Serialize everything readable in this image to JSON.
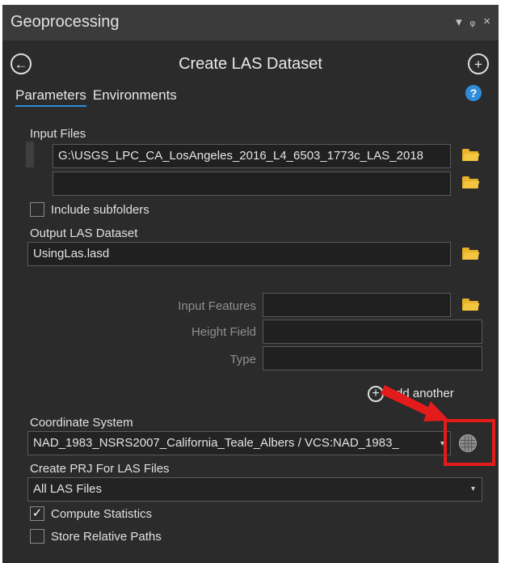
{
  "window": {
    "title": "Geoprocessing",
    "controls": {
      "menu": "▾",
      "pin": "ᵩ",
      "close": "×"
    }
  },
  "tool": {
    "title": "Create LAS Dataset",
    "back_icon": "arrow-left-icon",
    "add_icon": "plus-icon"
  },
  "tabs": [
    {
      "label": "Parameters",
      "active": true
    },
    {
      "label": "Environments",
      "active": false
    }
  ],
  "help_label": "?",
  "input_files": {
    "label": "Input Files",
    "values": [
      "G:\\USGS_LPC_CA_LosAngeles_2016_L4_6503_1773c_LAS_2018",
      ""
    ]
  },
  "include_subfolders": {
    "label": "Include subfolders",
    "checked": false
  },
  "output": {
    "label": "Output LAS Dataset",
    "value": "UsingLas.lasd"
  },
  "surface_constraints": {
    "input_features_label": "Input Features",
    "height_field_label": "Height Field",
    "type_label": "Type",
    "add_another_label": "Add another"
  },
  "coordinate_system": {
    "label": "Coordinate System",
    "value": "NAD_1983_NSRS2007_California_Teale_Albers / VCS:NAD_1983_"
  },
  "prj": {
    "label": "Create PRJ For LAS Files",
    "value": "All LAS Files"
  },
  "compute_statistics": {
    "label": "Compute Statistics",
    "checked": true,
    "check_glyph": "✓"
  },
  "relative_paths": {
    "label": "Store Relative Paths",
    "checked": false
  },
  "colors": {
    "panel": "#2b2b2b",
    "accent": "#2f8cd8",
    "folder": "#e8b32a",
    "annotation": "#e31b1b"
  }
}
